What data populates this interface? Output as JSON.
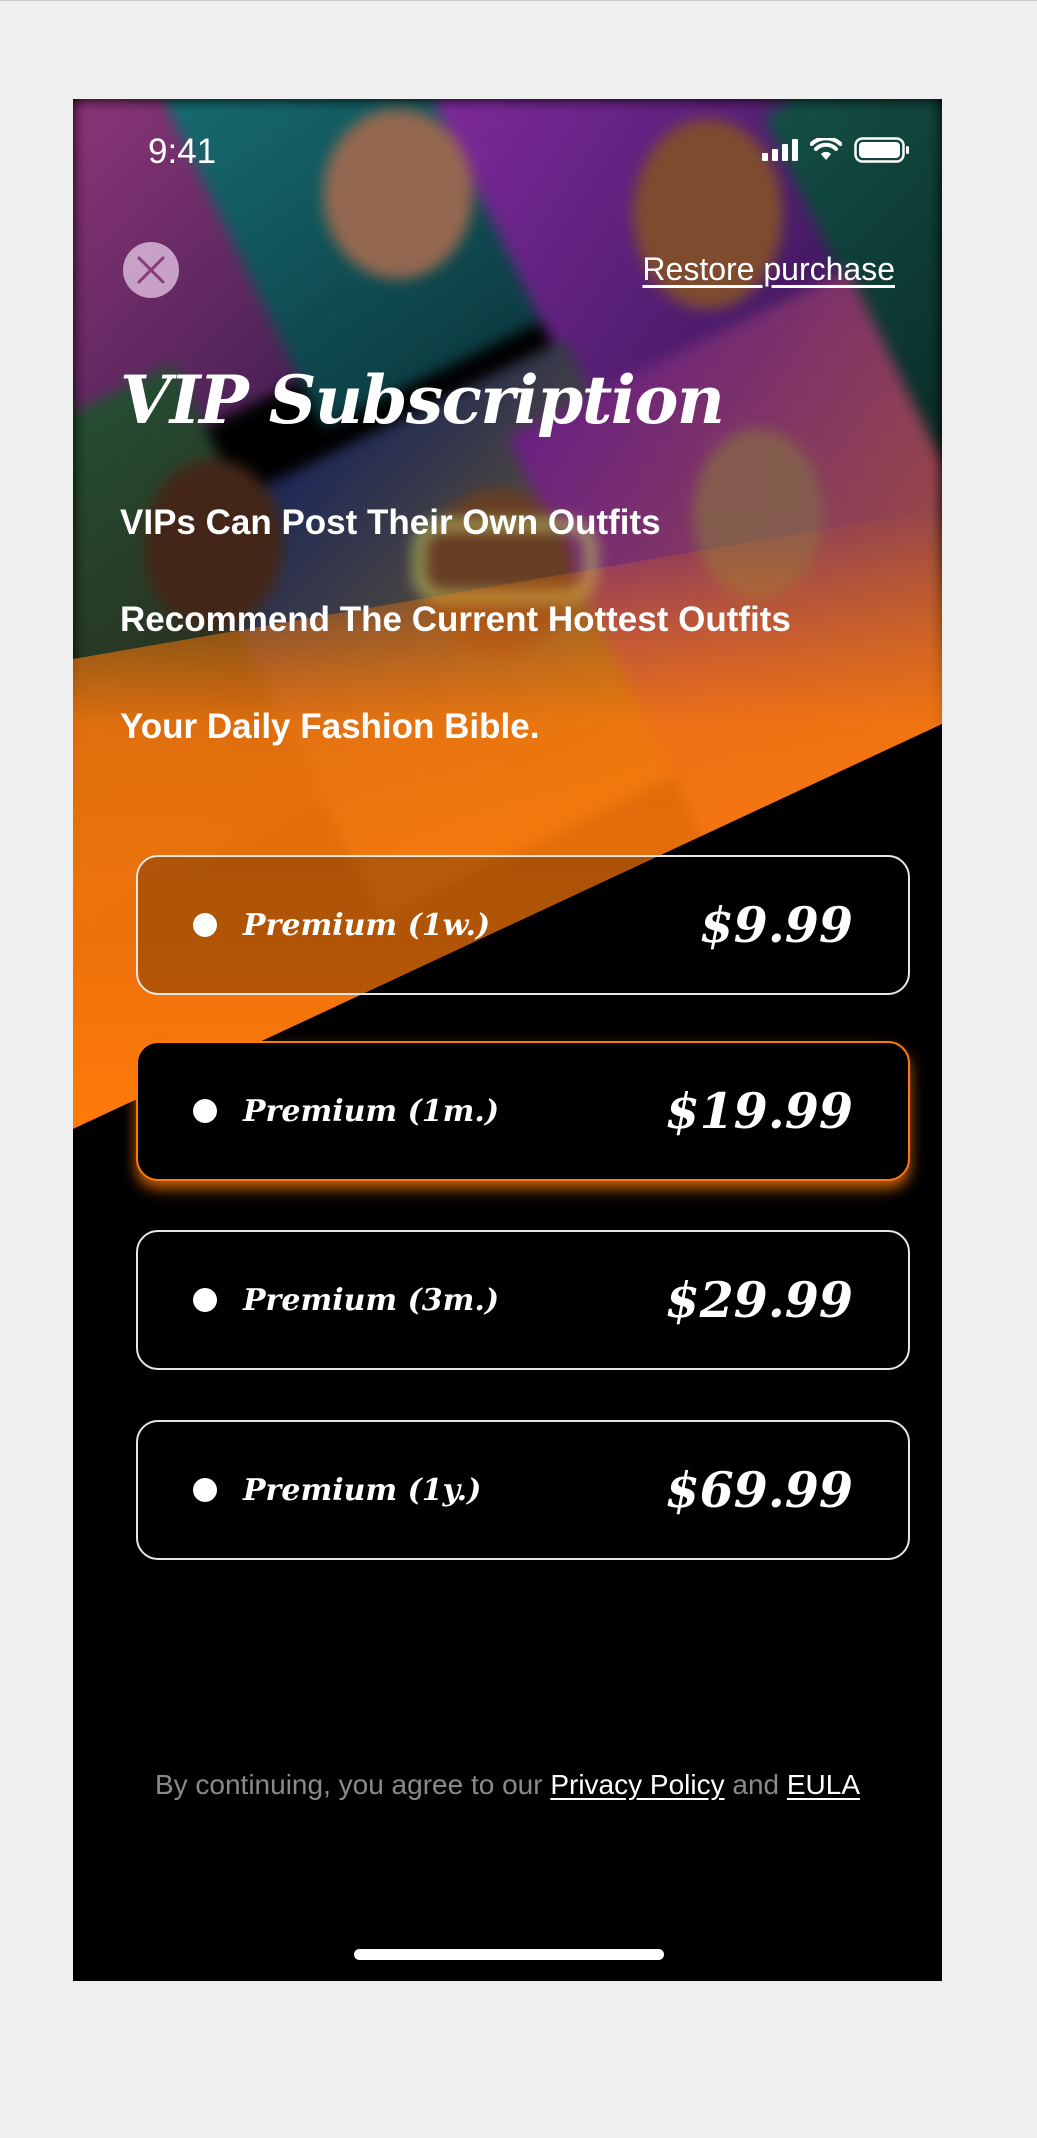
{
  "status_bar": {
    "time": "9:41"
  },
  "header": {
    "restore_label": "Restore purchase"
  },
  "title": "VIP Subscription",
  "features": [
    "VIPs Can Post Their Own Outfits",
    "Recommend The Current Hottest Outfits",
    "Your Daily Fashion Bible."
  ],
  "plans": [
    {
      "name": "Premium (1w.)",
      "price": "$9.99",
      "selected": false
    },
    {
      "name": "Premium (1m.)",
      "price": "$19.99",
      "selected": true
    },
    {
      "name": "Premium (3m.)",
      "price": "$29.99",
      "selected": false
    },
    {
      "name": "Premium (1y.)",
      "price": "$69.99",
      "selected": false
    }
  ],
  "legal": {
    "prefix": "By continuing, you agree to our",
    "privacy_link": "Privacy Policy",
    "and": "and",
    "eula_link": "EULA"
  },
  "colors": {
    "accent": "#ff7a0a",
    "background": "#000000",
    "page_background": "#efefef"
  },
  "icons": [
    "close-icon",
    "signal-icon",
    "wifi-icon",
    "battery-icon"
  ]
}
